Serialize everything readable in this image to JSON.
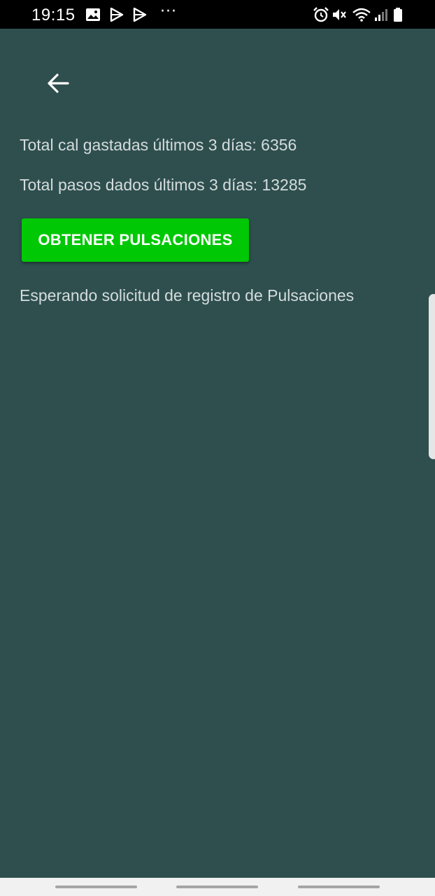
{
  "status_bar": {
    "time": "19:15",
    "left_icons": [
      "image-icon",
      "play-store-icon",
      "play-store-icon",
      "more-dots-icon"
    ],
    "more_dots": "···",
    "right_icons": [
      "alarm-icon",
      "mute-icon",
      "wifi-icon",
      "signal-icon",
      "battery-icon"
    ]
  },
  "toolbar": {
    "back_icon": "arrow-left-icon"
  },
  "content": {
    "calories_text": "Total cal gastadas últimos 3 días: 6356",
    "steps_text": "Total pasos dados últimos 3 días: 13285",
    "pulse_button_label": "OBTENER PULSACIONES",
    "status_text": "Esperando solicitud de registro de Pulsaciones"
  },
  "colors": {
    "background": "#2f4f4f",
    "accent_button": "#00c805",
    "text": "#d5dcdc"
  }
}
